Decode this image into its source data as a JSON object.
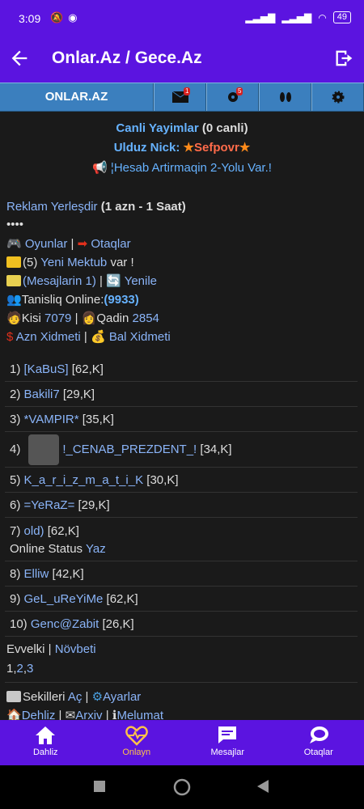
{
  "status": {
    "time": "3:09",
    "battery": "49"
  },
  "app": {
    "title": "Onlar.Az / Gece.Az"
  },
  "tabs": {
    "main": "ONLAR.AZ",
    "mail_badge": "1",
    "notify_badge": "5"
  },
  "header_info": {
    "live": "Canli Yayimlar",
    "live_count": "(0 canli)",
    "nick_label": "Ulduz Nick:",
    "nick": "Sefpovr",
    "promo": "¦Hesab Artirmaqin 2-Yolu Var.!"
  },
  "links": {
    "ad": "Reklam Yerleşdir",
    "ad_detail": "(1 azn - 1 Saat)",
    "dots": "••••",
    "games": "Oyunlar",
    "rooms": "Otaqlar",
    "new_mail_count": "(5)",
    "new_mail": "Yeni Mektub",
    "new_mail_suffix": "var !",
    "messages": "(Mesajlarin 1)",
    "refresh": "Yenile",
    "online_label": "Tanisliq Online:",
    "online_count": "(9933)",
    "male_label": "Kisi",
    "male_count": "7079",
    "female_label": "Qadin",
    "female_count": "2854",
    "azn_service": "Azn Xidmeti",
    "bal_service": "Bal Xidmeti"
  },
  "users": [
    {
      "rank": "1)",
      "name": "[KaBuS]",
      "info": "[62,K]"
    },
    {
      "rank": "2)",
      "name": "Bakili7",
      "info": "[29,K]"
    },
    {
      "rank": "3)",
      "name": "*VAMPIR*",
      "info": "[35,K]"
    },
    {
      "rank": "4)",
      "name": "!_CENAB_PREZDENT_!",
      "info": "[34,K]"
    },
    {
      "rank": "5)",
      "name": "K_a_r_i_z_m_a_t_i_K",
      "info": "[30,K]"
    },
    {
      "rank": "6)",
      "name": "=YeRaZ=",
      "info": "[29,K]"
    },
    {
      "rank": "7)",
      "name": "old)",
      "info": "[62,K]"
    },
    {
      "rank": "8)",
      "name": "Elliw",
      "info": "[42,K]"
    },
    {
      "rank": "9)",
      "name": "GeL_uReYiMe",
      "info": "[62,K]"
    },
    {
      "rank": "10)",
      "name": "Genc@Zabit",
      "info": "[26,K]"
    }
  ],
  "online_status": {
    "label": "Online Status",
    "link": "Yaz"
  },
  "pager": {
    "prev": "Evvelki",
    "next": "Növbeti",
    "p1": "1",
    "p2": "2",
    "p3": "3"
  },
  "footer_links": {
    "pics": "Sekilleri",
    "pics_link": "Aç",
    "settings": "Ayarlar",
    "lobby": "Dehliz",
    "archive": "Arxiv",
    "info": "Melumat"
  },
  "bottom_nav": [
    {
      "label": "Dahliz"
    },
    {
      "label": "Onlayn"
    },
    {
      "label": "Mesajlar"
    },
    {
      "label": "Otaqlar"
    }
  ]
}
